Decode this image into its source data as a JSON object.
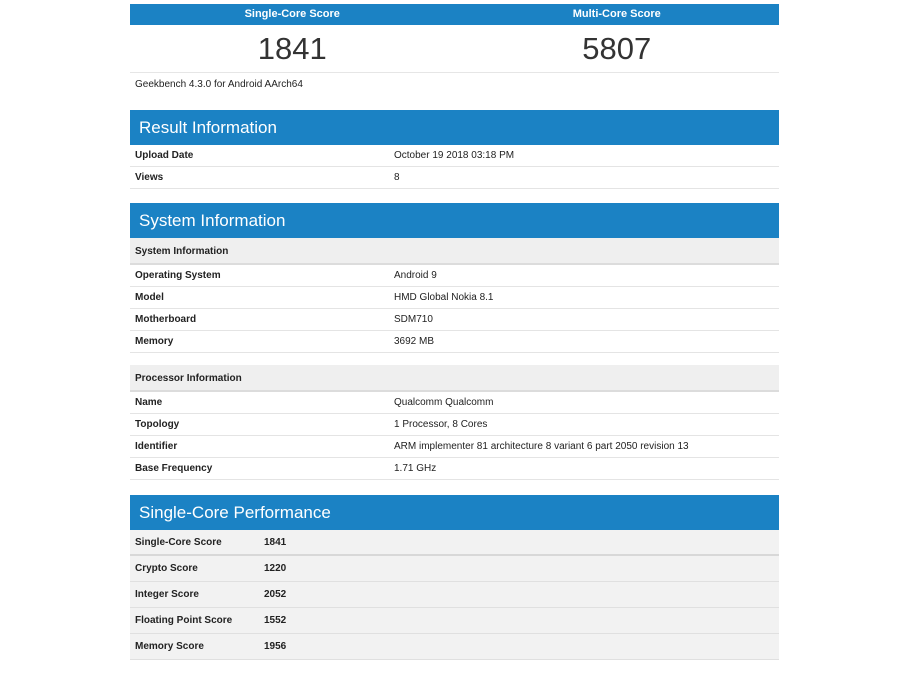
{
  "scores": {
    "single_label": "Single-Core Score",
    "multi_label": "Multi-Core Score",
    "single_value": "1841",
    "multi_value": "5807",
    "version": "Geekbench 4.3.0 for Android AArch64"
  },
  "result_info": {
    "title": "Result Information",
    "rows": [
      {
        "key": "Upload Date",
        "value": "October 19 2018 03:18 PM"
      },
      {
        "key": "Views",
        "value": "8"
      }
    ]
  },
  "system_info": {
    "title": "System Information",
    "system": {
      "heading": "System Information",
      "rows": [
        {
          "key": "Operating System",
          "value": "Android 9"
        },
        {
          "key": "Model",
          "value": "HMD Global Nokia 8.1"
        },
        {
          "key": "Motherboard",
          "value": "SDM710"
        },
        {
          "key": "Memory",
          "value": "3692 MB"
        }
      ]
    },
    "processor": {
      "heading": "Processor Information",
      "rows": [
        {
          "key": "Name",
          "value": "Qualcomm Qualcomm"
        },
        {
          "key": "Topology",
          "value": "1 Processor, 8 Cores"
        },
        {
          "key": "Identifier",
          "value": "ARM implementer 81 architecture 8 variant 6 part 2050 revision 13"
        },
        {
          "key": "Base Frequency",
          "value": "1.71 GHz"
        }
      ]
    }
  },
  "single_core": {
    "title": "Single-Core Performance",
    "rows": [
      {
        "key": "Single-Core Score",
        "value": "1841"
      },
      {
        "key": "Crypto Score",
        "value": "1220"
      },
      {
        "key": "Integer Score",
        "value": "2052"
      },
      {
        "key": "Floating Point Score",
        "value": "1552"
      },
      {
        "key": "Memory Score",
        "value": "1956"
      }
    ]
  },
  "colors": {
    "header_blue": "#1b82c4",
    "sub_header_gray": "#efefef"
  }
}
